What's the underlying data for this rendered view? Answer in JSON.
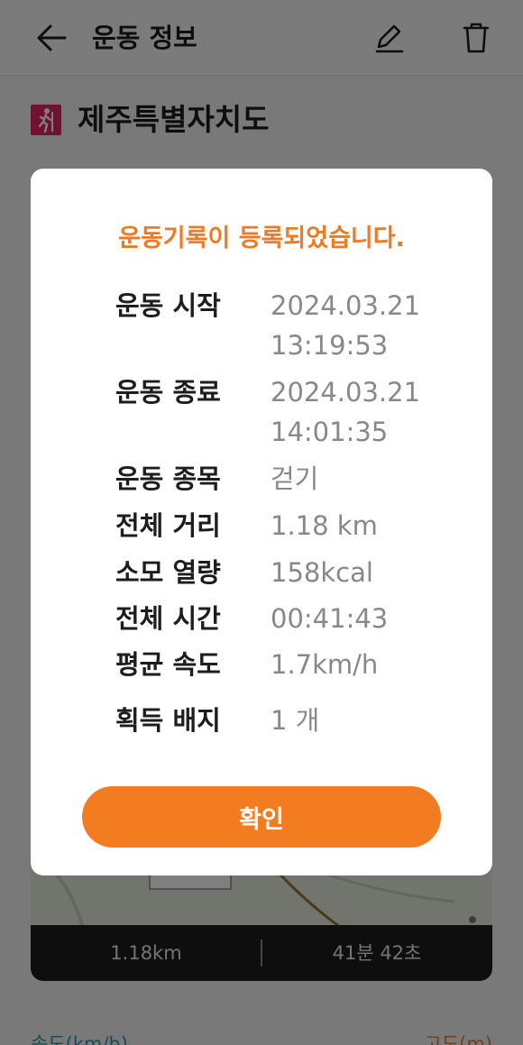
{
  "header": {
    "title": "운동 정보"
  },
  "location": {
    "name": "제주특별자치도"
  },
  "map_stats": {
    "distance": "1.18km",
    "duration": "41분 42초"
  },
  "bottom": {
    "left_label": "속도(km/h)",
    "right_label": "고도(m)"
  },
  "dialog": {
    "title": "운동기록이 등록되었습니다.",
    "start": {
      "label": "운동 시작",
      "date": "2024.03.21",
      "time": "13:19:53"
    },
    "end": {
      "label": "운동 종료",
      "date": "2024.03.21",
      "time": "14:01:35"
    },
    "type": {
      "label": "운동 종목",
      "value": "걷기"
    },
    "distance": {
      "label": "전체 거리",
      "value": "1.18 km"
    },
    "calories": {
      "label": "소모 열량",
      "value": "158kcal"
    },
    "total_time": {
      "label": "전체 시간",
      "value": "00:41:43"
    },
    "avg_speed": {
      "label": "평균 속도",
      "value": "1.7km/h"
    },
    "badges": {
      "label": "획득 배지",
      "value": "1 개"
    },
    "confirm_label": "확인"
  },
  "colors": {
    "accent": "#f47c20",
    "title_orange": "#ef7a25",
    "value_gray": "#888888"
  },
  "icons": [
    "arrow-left-icon",
    "pencil-icon",
    "trash-icon",
    "walking-icon"
  ]
}
